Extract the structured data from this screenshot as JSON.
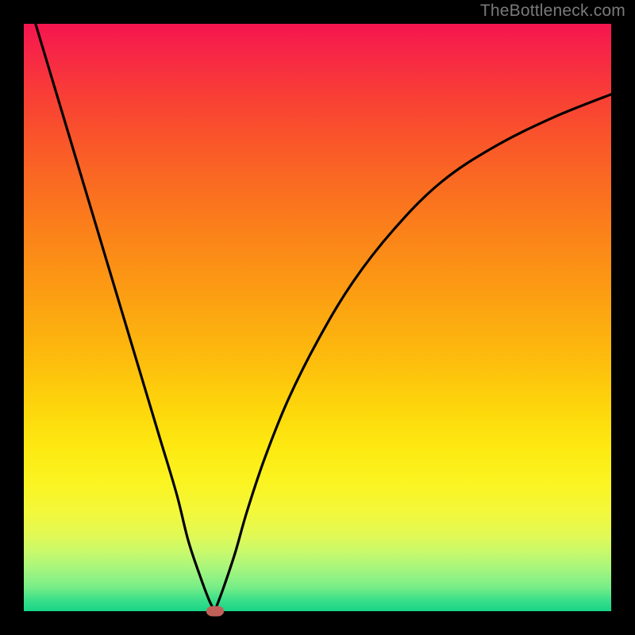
{
  "watermark": "TheBottleneck.com",
  "colors": {
    "frame": "#000000",
    "curve": "#000000",
    "marker": "#c06058",
    "gradient_top": "#f6154f",
    "gradient_bottom": "#17d488"
  },
  "chart_data": {
    "type": "line",
    "title": "",
    "xlabel": "",
    "ylabel": "",
    "xlim": [
      0,
      100
    ],
    "ylim": [
      0,
      100
    ],
    "grid": false,
    "series": [
      {
        "name": "left-branch",
        "x": [
          2,
          5,
          8,
          11,
          14,
          17,
          20,
          23,
          26,
          28,
          30,
          31.5,
          32.5
        ],
        "y": [
          100,
          90,
          80,
          70,
          60,
          50,
          40,
          30,
          20,
          12,
          6,
          2,
          0
        ]
      },
      {
        "name": "right-branch",
        "x": [
          32.5,
          34,
          36,
          38,
          41,
          45,
          50,
          56,
          63,
          71,
          80,
          90,
          100
        ],
        "y": [
          0,
          4,
          10,
          17,
          26,
          36,
          46,
          56,
          65,
          73,
          79,
          84,
          88
        ]
      }
    ],
    "annotations": [
      {
        "name": "minimum-marker",
        "x": 32.5,
        "y": 0
      }
    ]
  }
}
